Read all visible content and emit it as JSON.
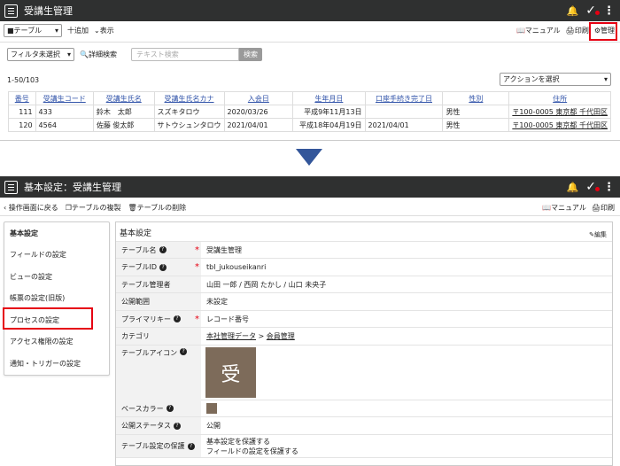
{
  "top": {
    "title": "受講生管理",
    "view_select": "■テーブル",
    "add": "十追加",
    "display": "表示",
    "manual": "マニュアル",
    "print": "印刷",
    "manage": "管理",
    "filter_select": "フィルタ未選択",
    "detail_search": "詳細検索",
    "search_placeholder": "テキスト検索",
    "search_btn": "検索",
    "count": "1-50/103",
    "action_select": "アクションを選択",
    "columns": [
      "番号",
      "受講生コード",
      "受講生氏名",
      "受講生氏名カナ",
      "入会日",
      "生年月日",
      "口座手続き完了日",
      "性別",
      "住所"
    ],
    "rows": [
      [
        "111",
        "433",
        "鈴木　太郎",
        "スズキタロウ",
        "2020/03/26",
        "平成9年11月13日",
        "",
        "男性",
        "〒100-0005 東京都 千代田区"
      ],
      [
        "120",
        "4564",
        "佐藤 俊太郎",
        "サトウシュンタロウ",
        "2021/04/01",
        "平成18年04月19日",
        "2021/04/01",
        "男性",
        "〒100-0005 東京都 千代田区"
      ]
    ]
  },
  "bottom": {
    "title": "基本設定：受講生管理",
    "back": "操作画面に戻る",
    "copy": "テーブルの複製",
    "delete": "テーブルの削除",
    "manual": "マニュアル",
    "print": "印刷",
    "side_items": [
      "基本設定",
      "フィールドの設定",
      "ビューの設定",
      "帳票の設定(旧版)",
      "プロセスの設定",
      "アクセス権限の設定",
      "通知・トリガーの設定"
    ],
    "panel_title": "基本設定",
    "edit": "編集",
    "fields": {
      "name_label": "テーブル名",
      "name_value": "受講生管理",
      "id_label": "テーブルID",
      "id_value": "tbl_jukouseikanri",
      "admin_label": "テーブル管理者",
      "admin_value": "山田 一郎 / 西岡 たかし / 山口 未央子",
      "scope_label": "公開範囲",
      "scope_value": "未設定",
      "pk_label": "プライマリキー",
      "pk_value": "レコード番号",
      "cat_label": "カテゴリ",
      "cat_link1": "本社管理データ",
      "cat_sep": ">",
      "cat_link2": "会員管理",
      "icon_label": "テーブルアイコン",
      "icon_char": "受",
      "color_label": "ベースカラー",
      "status_label": "公開ステータス",
      "status_value": "公開",
      "protect_label": "テーブル設定の保護",
      "protect_value1": "基本設定を保護する",
      "protect_value2": "フィールドの設定を保護する"
    }
  },
  "colors": {
    "bar": "#2f3030",
    "accent_red": "#e60012",
    "arrow": "#33569a",
    "icon_bg": "#7d6b5a"
  }
}
